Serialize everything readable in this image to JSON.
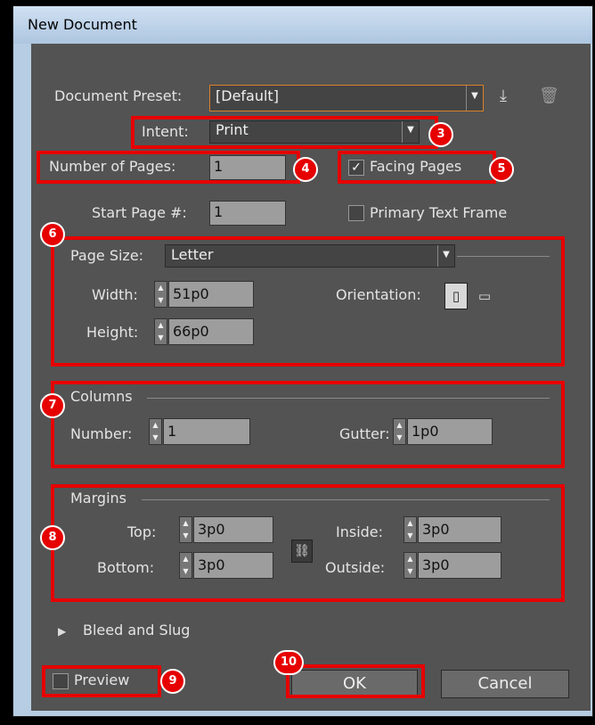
{
  "window": {
    "title": "New Document"
  },
  "preset": {
    "label": "Document Preset:",
    "value": "[Default]"
  },
  "intent": {
    "label": "Intent:",
    "value": "Print"
  },
  "pages": {
    "label": "Number of Pages:",
    "value": "1"
  },
  "facing": {
    "label": "Facing Pages",
    "checked": true
  },
  "start_page": {
    "label": "Start Page #:",
    "value": "1"
  },
  "primary_text": {
    "label": "Primary Text Frame",
    "checked": false
  },
  "page_size": {
    "label": "Page Size:",
    "value": "Letter"
  },
  "width": {
    "label": "Width:",
    "value": "51p0"
  },
  "height": {
    "label": "Height:",
    "value": "66p0"
  },
  "orientation": {
    "label": "Orientation:"
  },
  "columns": {
    "title": "Columns",
    "number_label": "Number:",
    "number": "1",
    "gutter_label": "Gutter:",
    "gutter": "1p0"
  },
  "margins": {
    "title": "Margins",
    "top_label": "Top:",
    "top": "3p0",
    "bottom_label": "Bottom:",
    "bottom": "3p0",
    "inside_label": "Inside:",
    "inside": "3p0",
    "outside_label": "Outside:",
    "outside": "3p0"
  },
  "bleed": {
    "label": "Bleed and Slug"
  },
  "preview": {
    "label": "Preview",
    "checked": false
  },
  "buttons": {
    "ok": "OK",
    "cancel": "Cancel"
  },
  "badges": [
    "3",
    "4",
    "5",
    "6",
    "7",
    "8",
    "9",
    "10"
  ],
  "colors": {
    "highlight": "#e60000",
    "dialog_bg": "#535353"
  }
}
